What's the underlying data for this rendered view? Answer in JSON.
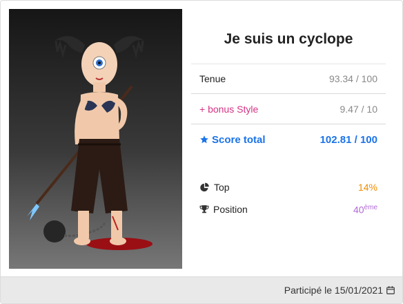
{
  "card": {
    "title": "Je suis un cyclope",
    "avatar_description_icon": "avatar-illustration"
  },
  "scores": {
    "tenue_label": "Tenue",
    "tenue_value": "93.34 / 100",
    "bonus_label": "+ bonus Style",
    "bonus_value": "9.47 / 10",
    "total_label": "Score total",
    "total_value": "102.81 / 100"
  },
  "stats": {
    "top_label": "Top",
    "top_value": "14%",
    "position_label": "Position",
    "position_value": "40",
    "position_suffix": "ème"
  },
  "footer": {
    "participated_text": "Participé le 15/01/2021"
  },
  "colors": {
    "accent_blue": "#1a73e8",
    "bonus_pink": "#d63384",
    "top_orange": "#f08c00",
    "position_purple": "#b06ad8"
  },
  "icons": {
    "total": "star-icon",
    "top": "pie-chart-icon",
    "position": "trophy-icon",
    "date": "calendar-icon"
  }
}
